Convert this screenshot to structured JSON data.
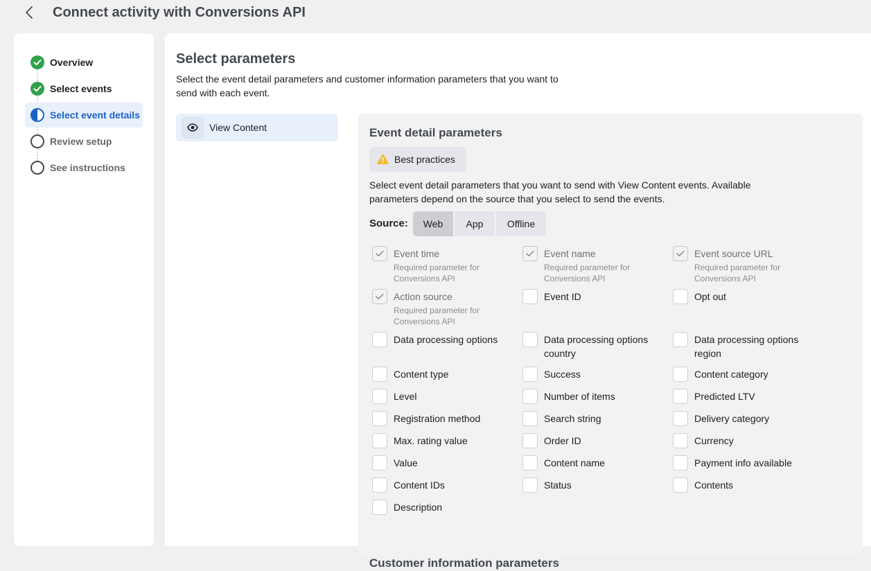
{
  "header": {
    "title": "Connect activity with Conversions API",
    "back_icon": "chevron-left-icon"
  },
  "sidebar": {
    "steps": [
      {
        "label": "Overview",
        "status": "complete",
        "icon": "check-circle-icon"
      },
      {
        "label": "Select events",
        "status": "complete",
        "icon": "check-circle-icon"
      },
      {
        "label": "Select event details",
        "status": "current",
        "icon": "half-circle-icon"
      },
      {
        "label": "Review setup",
        "status": "pending",
        "icon": "empty-circle-icon"
      },
      {
        "label": "See instructions",
        "status": "pending",
        "icon": "empty-circle-icon"
      }
    ]
  },
  "main": {
    "title": "Select parameters",
    "description": "Select the event detail parameters and customer information parameters that you want to send with each event.",
    "event_item": {
      "label": "View Content",
      "icon": "eye-icon"
    }
  },
  "panel": {
    "title": "Event detail parameters",
    "best_practices": {
      "label": "Best practices",
      "icon": "warning-icon"
    },
    "description": "Select event detail parameters that you want to send with View Content events. Available parameters depend on the source that you select to send the events.",
    "source": {
      "label": "Source:",
      "options": [
        "Web",
        "App",
        "Offline"
      ],
      "selected": "Web"
    },
    "required_note": "Required parameter for Conversions API",
    "params": [
      {
        "label": "Event time",
        "checked": true,
        "required": true
      },
      {
        "label": "Event name",
        "checked": true,
        "required": true
      },
      {
        "label": "Event source URL",
        "checked": true,
        "required": true
      },
      {
        "label": "Action source",
        "checked": true,
        "required": true
      },
      {
        "label": "Event ID",
        "checked": false
      },
      {
        "label": "Opt out",
        "checked": false
      },
      {
        "label": "Data processing options",
        "checked": false
      },
      {
        "label": "Data processing options country",
        "checked": false
      },
      {
        "label": "Data processing options region",
        "checked": false
      },
      {
        "label": "Content type",
        "checked": false
      },
      {
        "label": "Success",
        "checked": false
      },
      {
        "label": "Content category",
        "checked": false
      },
      {
        "label": "Level",
        "checked": false
      },
      {
        "label": "Number of items",
        "checked": false
      },
      {
        "label": "Predicted LTV",
        "checked": false
      },
      {
        "label": "Registration method",
        "checked": false
      },
      {
        "label": "Search string",
        "checked": false
      },
      {
        "label": "Delivery category",
        "checked": false
      },
      {
        "label": "Max. rating value",
        "checked": false
      },
      {
        "label": "Order ID",
        "checked": false
      },
      {
        "label": "Currency",
        "checked": false
      },
      {
        "label": "Value",
        "checked": false
      },
      {
        "label": "Content name",
        "checked": false
      },
      {
        "label": "Payment info available",
        "checked": false
      },
      {
        "label": "Content IDs",
        "checked": false
      },
      {
        "label": "Status",
        "checked": false
      },
      {
        "label": "Contents",
        "checked": false
      },
      {
        "label": "Description",
        "checked": false
      }
    ],
    "customer_title": "Customer information parameters"
  },
  "colors": {
    "complete": "#31a24c",
    "current": "#1b63c7",
    "pending": "#65676b",
    "warning": "#f7b928"
  }
}
